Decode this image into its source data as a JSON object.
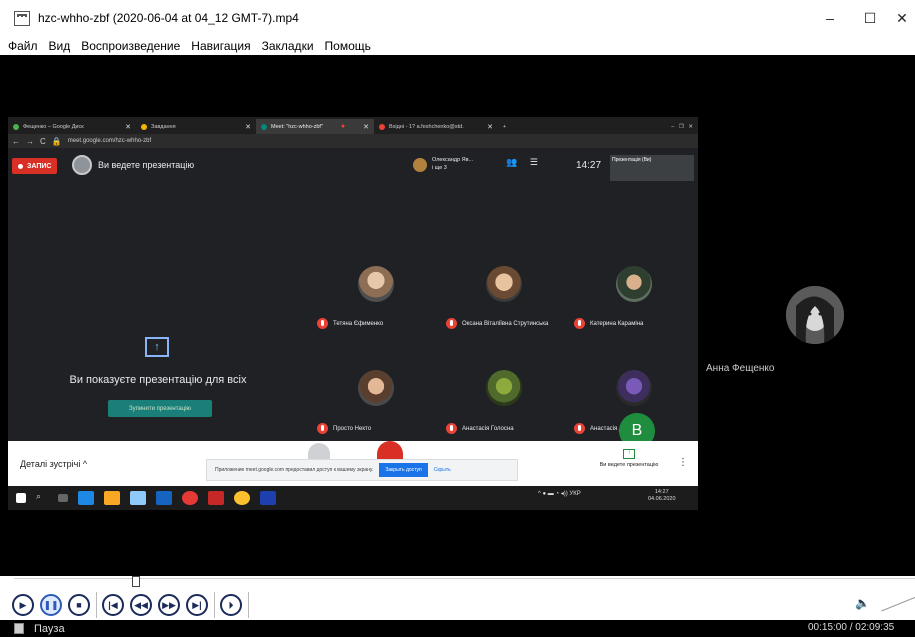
{
  "window": {
    "title": "hzc-whho-zbf (2020-06-04 at 04_12 GMT-7).mp4",
    "min": "–",
    "max": "☐",
    "close": "✕"
  },
  "menu": [
    "Файл",
    "Вид",
    "Воспроизведение",
    "Навигация",
    "Закладки",
    "Помощь"
  ],
  "browser": {
    "tabs": [
      {
        "label": "Фещенко – Google Диск",
        "color": "#4caf50"
      },
      {
        "label": "Завдання",
        "color": "#f4b400"
      },
      {
        "label": "Meet: \"hzc-whho-zbf\"",
        "color": "#00897b"
      },
      {
        "label": "Вхідні - 1? a.feshchenko@std.",
        "color": "#ea4335"
      }
    ],
    "url": "meet.google.com/hzc-whho-zbf"
  },
  "meet": {
    "rec_label": "ЗАПИС",
    "presenting_text": "Ви ведете презентацію",
    "owner_name": "Олександр Яв...",
    "owner_sub": "і ще 3",
    "time": "14:27",
    "self_tile": "Презентація (Ви)",
    "share_text": "Ви показуєте презентацію для всіх",
    "stop_share": "Зупинити презентацію",
    "participants": [
      {
        "name": "Тетяна Єфименко"
      },
      {
        "name": "Оксана Віталіївна Струтинська"
      },
      {
        "name": "Катерина Караміна"
      },
      {
        "name": "Просто Некто"
      },
      {
        "name": "Анастасія Голосна"
      },
      {
        "name": "Анастасія Дидилюк"
      }
    ],
    "avatar_b": "B",
    "details": "Деталі зустрічі ^",
    "notice": "Приложение meet.google.com предоставил доступ к вашему экрану.",
    "notice_stop": "Закрыть доступ",
    "notice_hide": "Скрыть",
    "presenting_btn": "Ви ведете презентацію"
  },
  "taskbar": {
    "clock_time": "14:27",
    "clock_date": "04.06.2020",
    "lang": "УКР"
  },
  "remote": {
    "name": "Анна Фещенко"
  },
  "player": {
    "status": "Пауза",
    "time": "00:15:00 / 02:09:35"
  },
  "colors": {
    "record": "#d93025",
    "accent": "#1a73e8",
    "teal": "#1a7e79"
  }
}
